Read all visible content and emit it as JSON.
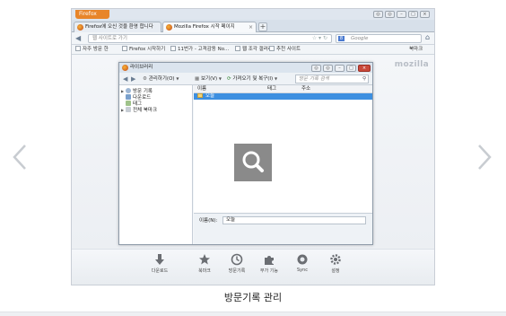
{
  "browser": {
    "app_button": "Firefox",
    "tabs": [
      {
        "label": "Firefox에 오신 것을 환영 합니다"
      },
      {
        "label": "Mozilla Firefox 시작 페이지"
      }
    ],
    "url_placeholder": "웹 사이트로 가기",
    "search_placeholder": "Google",
    "bookmarks_menu_label": "북마크",
    "bookmarks_bar": [
      {
        "label": "자주 방문 한"
      },
      {
        "label": "Firefox 시작하기"
      },
      {
        "label": "11번가 - 고객감동 No..."
      },
      {
        "label": "웹 조각 갤러리"
      },
      {
        "label": "추천 사이트"
      }
    ],
    "brand_watermark": "mozilla"
  },
  "library": {
    "title": "라이브러리",
    "toolbar": {
      "organize": "관리하기(O)",
      "views": "보기(V)",
      "import_backup": "가져오기 및 복구(I)",
      "search_placeholder": "방문 기록 검색"
    },
    "tree": [
      {
        "label": "방문 기록"
      },
      {
        "label": "다운로드"
      },
      {
        "label": "태그"
      },
      {
        "label": "전체 북마크"
      }
    ],
    "columns": {
      "name": "이름",
      "tags": "태그",
      "location": "주소"
    },
    "selected_row": "오늘",
    "detail": {
      "name_label": "이름(N):",
      "name_value": "오늘"
    }
  },
  "bottom_toolbar": [
    {
      "label": "다운로드",
      "icon": "download-icon"
    },
    {
      "label": "북마크",
      "icon": "star-icon"
    },
    {
      "label": "방문기록",
      "icon": "clock-icon"
    },
    {
      "label": "부가 기능",
      "icon": "puzzle-icon"
    },
    {
      "label": "Sync",
      "icon": "sync-icon"
    },
    {
      "label": "설정",
      "icon": "gear-icon"
    }
  ],
  "caption": "방문기록 관리",
  "colors": {
    "accent": "#3d8fe0",
    "firefox_orange": "#e8852a"
  }
}
